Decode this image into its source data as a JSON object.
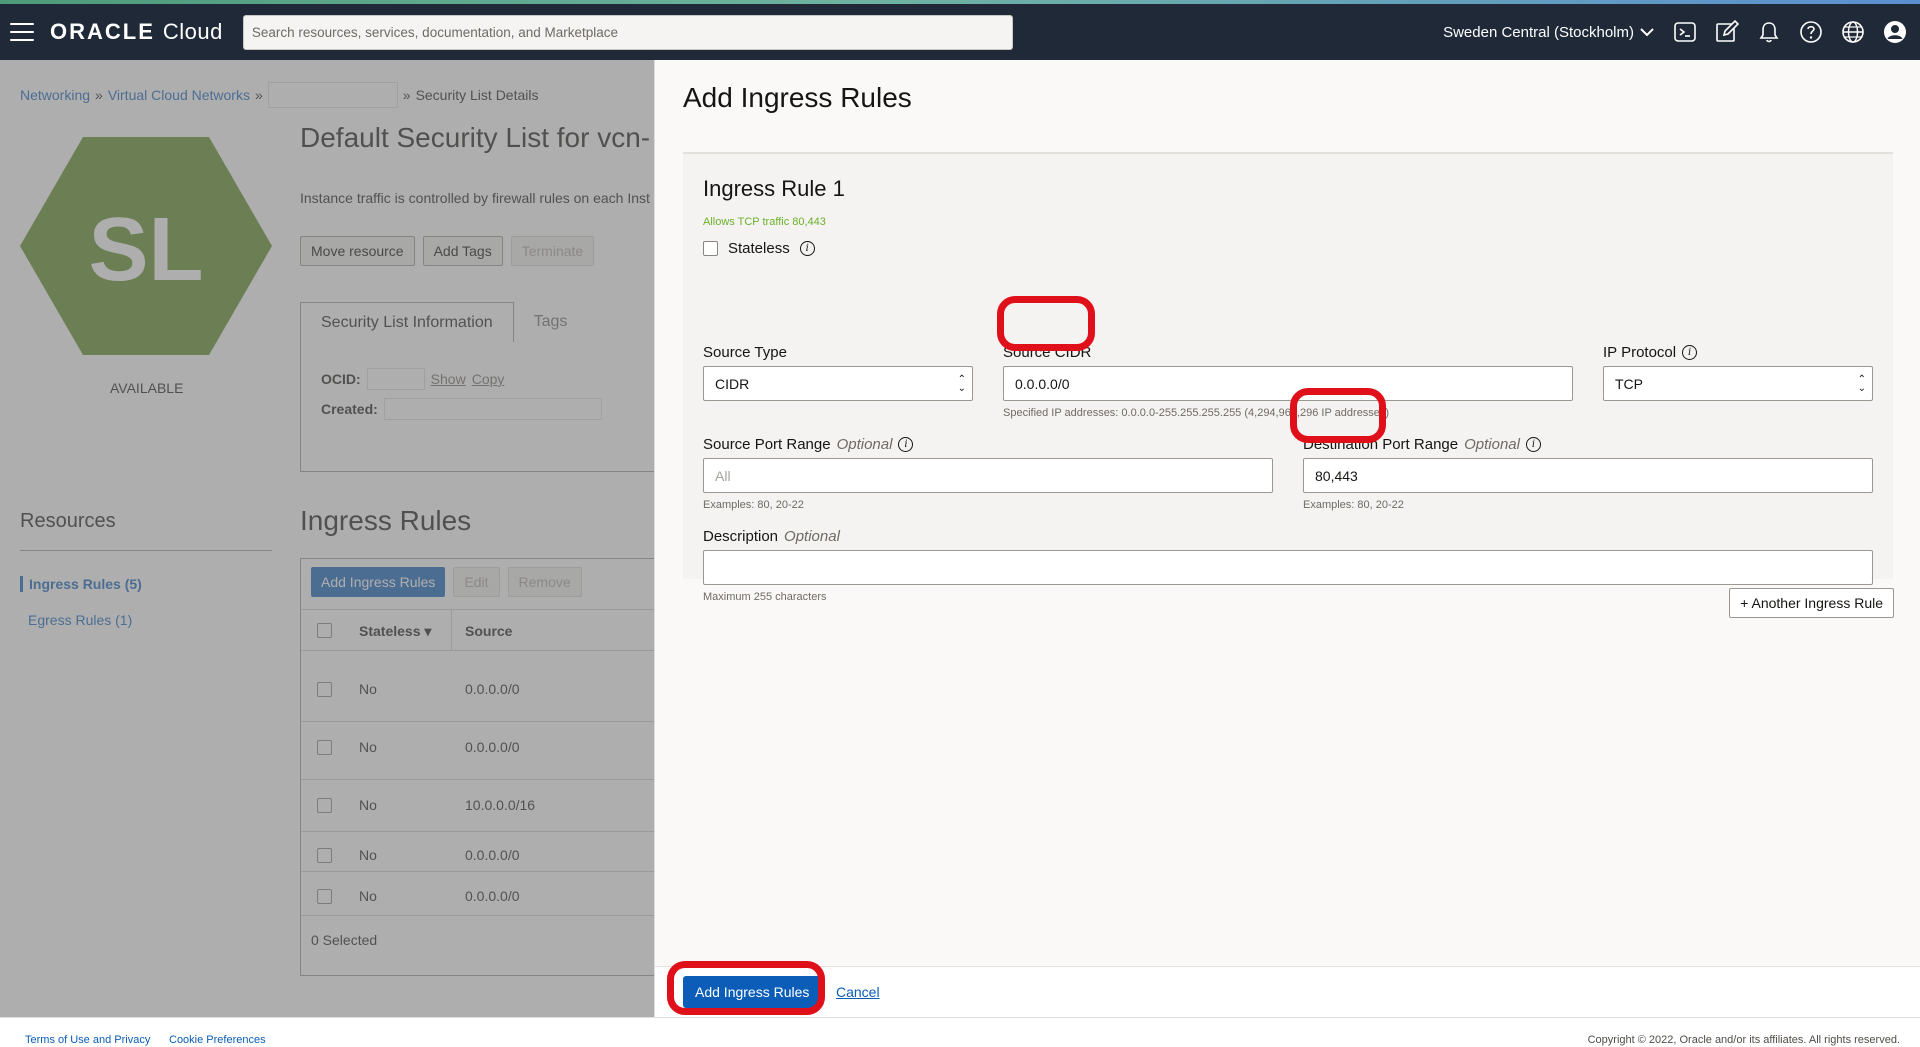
{
  "header": {
    "logo_brand": "ORACLE",
    "logo_product": "Cloud",
    "search_placeholder": "Search resources, services, documentation, and Marketplace",
    "region": "Sweden Central (Stockholm)"
  },
  "breadcrumb": {
    "items": [
      "Networking",
      "Virtual Cloud Networks"
    ],
    "current": "Security List Details"
  },
  "resource": {
    "icon_text": "SL",
    "status": "AVAILABLE",
    "title": "Default Security List for vcn-",
    "description": "Instance traffic is controlled by firewall rules on each Inst",
    "buttons": [
      "Move resource",
      "Add Tags",
      "Terminate"
    ],
    "tabs": [
      "Security List Information",
      "Tags"
    ],
    "ocid_label": "OCID:",
    "show_label": "Show",
    "copy_label": "Copy",
    "created_label": "Created:"
  },
  "resources_nav": {
    "title": "Resources",
    "items": [
      "Ingress Rules (5)",
      "Egress Rules (1)"
    ]
  },
  "ingress_table": {
    "title": "Ingress Rules",
    "buttons": [
      "Add Ingress Rules",
      "Edit",
      "Remove"
    ],
    "columns": [
      "Stateless",
      "Source"
    ],
    "rows": [
      {
        "stateless": "No",
        "source": "0.0.0.0/0"
      },
      {
        "stateless": "No",
        "source": "0.0.0.0/0"
      },
      {
        "stateless": "No",
        "source": "10.0.0.0/16"
      },
      {
        "stateless": "No",
        "source": "0.0.0.0/0"
      },
      {
        "stateless": "No",
        "source": "0.0.0.0/0"
      }
    ],
    "selected": "0 Selected"
  },
  "drawer": {
    "title": "Add Ingress Rules",
    "rule_title": "Ingress Rule 1",
    "allows_text": "Allows TCP traffic 80,443",
    "stateless_label": "Stateless",
    "source_type_label": "Source Type",
    "source_type_value": "CIDR",
    "source_cidr_label": "Source CIDR",
    "source_cidr_value": "0.0.0.0/0",
    "source_cidr_hint": "Specified IP addresses: 0.0.0.0-255.255.255.255 (4,294,967,296 IP addresses)",
    "ip_protocol_label": "IP Protocol",
    "ip_protocol_value": "TCP",
    "source_port_label": "Source Port Range",
    "source_port_placeholder": "All",
    "dest_port_label": "Destination Port Range",
    "dest_port_value": "80,443",
    "optional": "Optional",
    "port_hint": "Examples: 80, 20-22",
    "description_label": "Description",
    "description_hint": "Maximum 255 characters",
    "another_rule": "+ Another Ingress Rule",
    "submit": "Add Ingress Rules",
    "cancel": "Cancel"
  },
  "footer": {
    "terms": "Terms of Use and Privacy",
    "cookies": "Cookie Preferences",
    "copyright": "Copyright © 2022, Oracle and/or its affiliates. All rights reserved."
  },
  "colors": {
    "header_bg": "#1f2937",
    "primary": "#0b5db8",
    "hex_green": "#5b8a1f",
    "allows_green": "#6ab12b",
    "annotation_red": "#e0101b"
  }
}
